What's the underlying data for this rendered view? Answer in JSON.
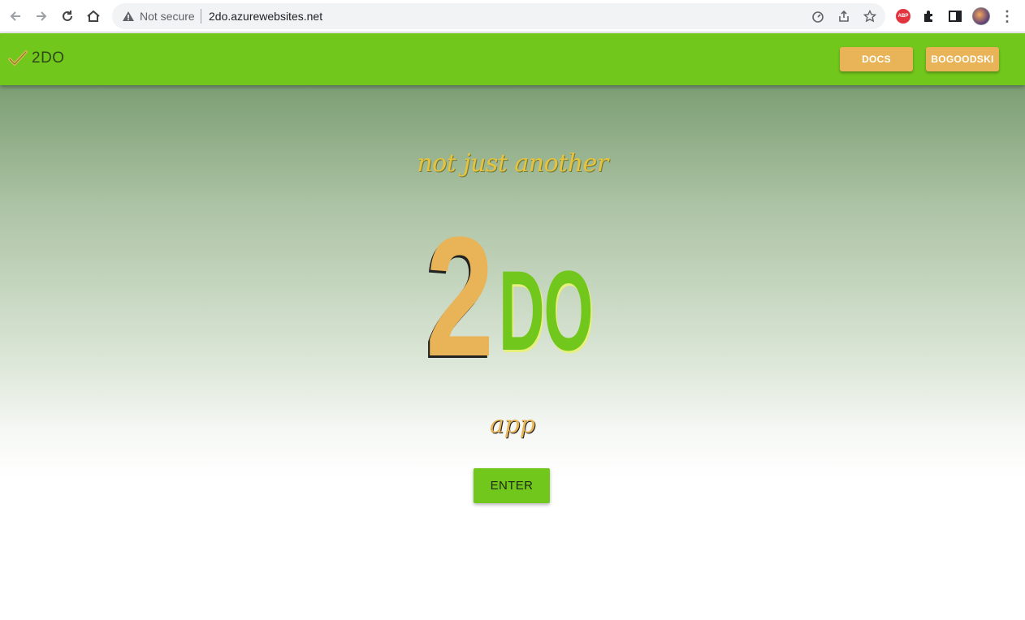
{
  "browser": {
    "security_text": "Not secure",
    "url": "2do.azurewebsites.net",
    "extensions": [
      "adblock-plus-icon",
      "puzzle-icon"
    ],
    "abp_label": "ABP"
  },
  "appbar": {
    "brand": "2DO",
    "docs_label": "DOCS",
    "user_label": "BOGOODSKI",
    "colors": {
      "bar": "#72c71c",
      "button": "#e9b457"
    }
  },
  "hero": {
    "tagline": "not just another",
    "logo_two": "2",
    "logo_do": "DO",
    "subtag": "app",
    "enter_label": "ENTER"
  }
}
